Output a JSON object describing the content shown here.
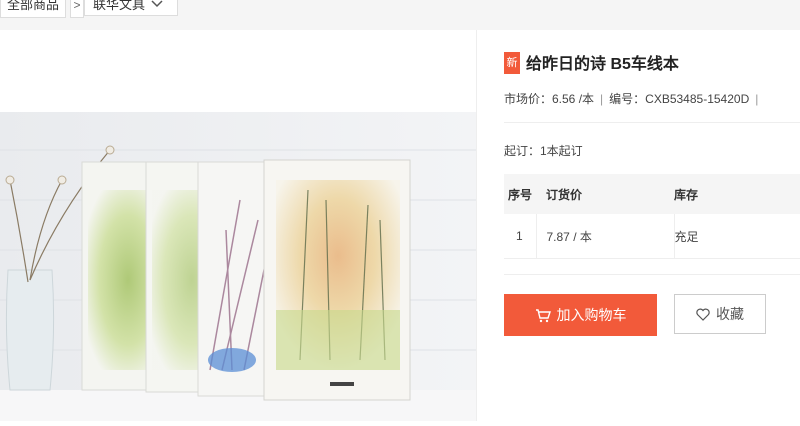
{
  "breadcrumb": {
    "all": "全部商品",
    "separator": ">",
    "category": "联华文具"
  },
  "product": {
    "badge": "新",
    "title": "给昨日的诗 B5车线本",
    "market_price": "市场价：6.56 /本",
    "sku": "编号：CXB53485-15420D",
    "moq": "起订：1本起订",
    "image_alt": "水彩植物封面笔记本"
  },
  "table": {
    "headers": [
      "序号",
      "订货价",
      "库存"
    ],
    "rows": [
      [
        "1",
        "7.87 / 本",
        "充足"
      ]
    ]
  },
  "actions": {
    "cart": "加入购物车",
    "favorite": "收藏"
  },
  "colors": {
    "accent": "#f25a3a"
  }
}
